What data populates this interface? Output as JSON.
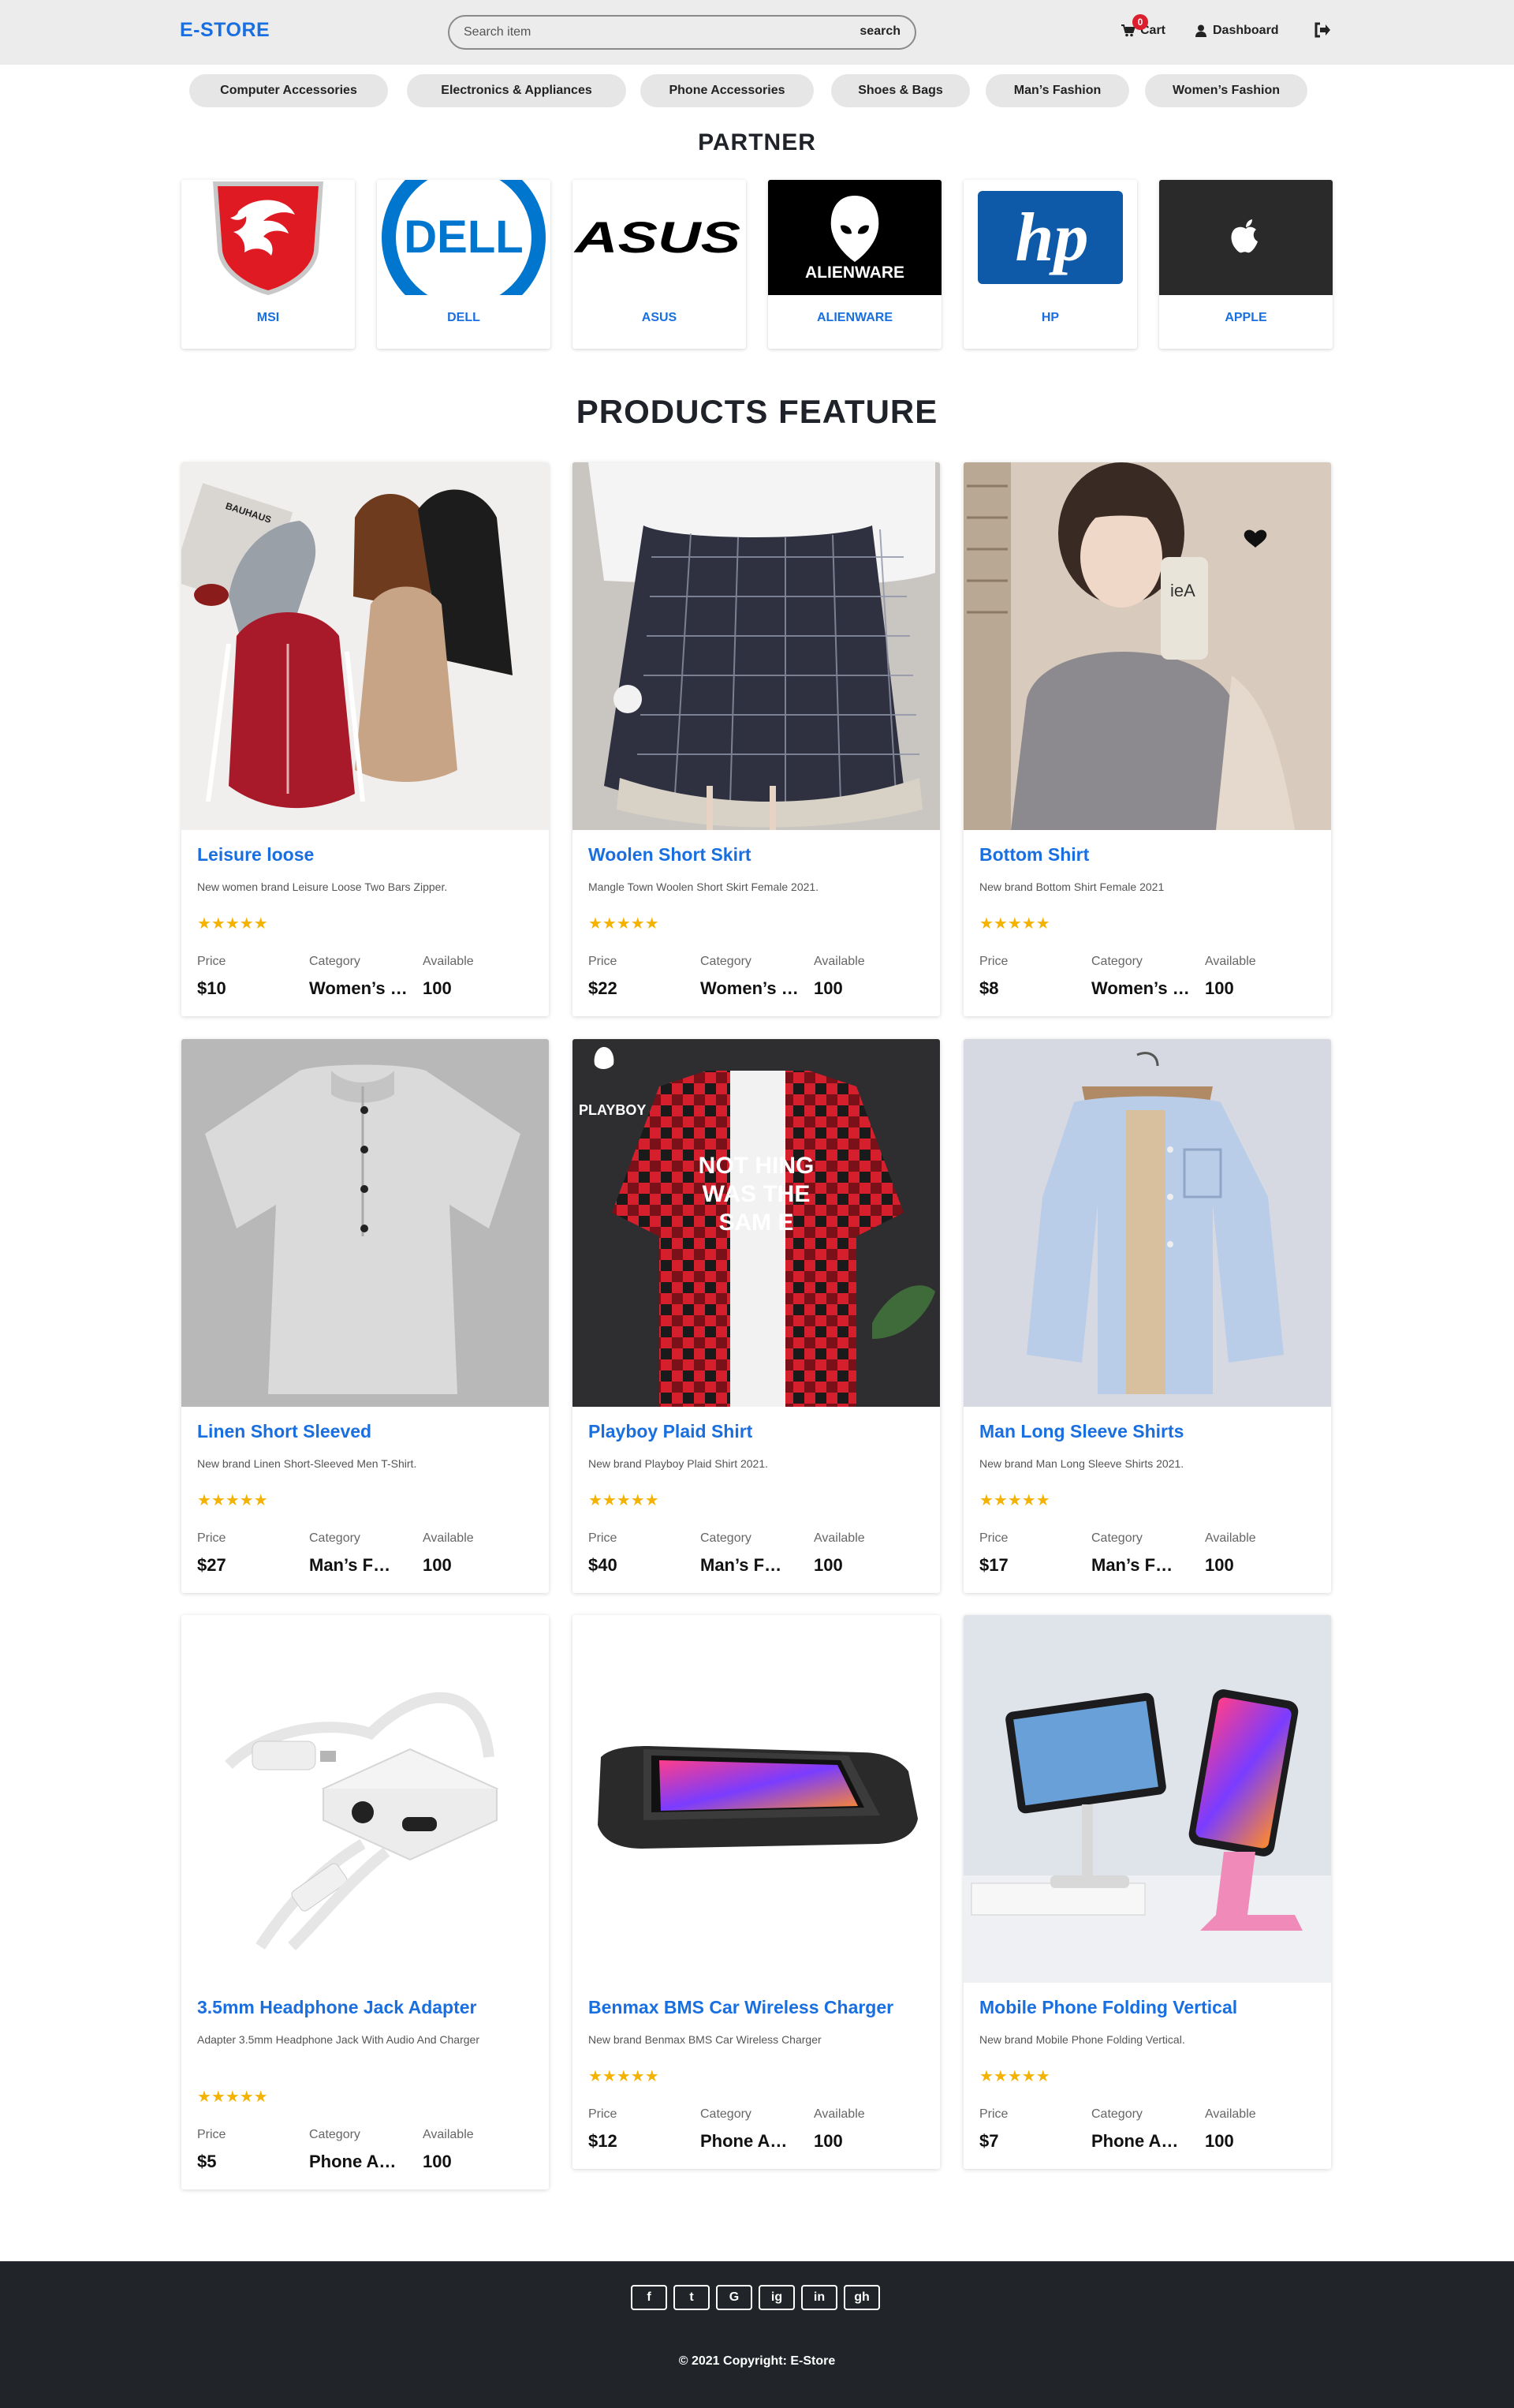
{
  "header": {
    "logo": "E-STORE",
    "search_placeholder": "Search item",
    "search_button": "search",
    "cart_count": "0",
    "cart_label": "Cart",
    "dashboard_label": "Dashboard"
  },
  "categories": [
    "Computer Accessories",
    "Electronics & Appliances",
    "Phone Accessories",
    "Shoes & Bags",
    "Man’s Fashion",
    "Women’s Fashion"
  ],
  "partners": {
    "title": "PARTNER",
    "items": [
      "MSI",
      "DELL",
      "ASUS",
      "ALIENWARE",
      "HP",
      "APPLE"
    ],
    "logo_text": {
      "dell": "DELL",
      "asus": "ASUS",
      "alienware": "ALIENWARE",
      "hp": "hp"
    }
  },
  "products": {
    "title": "PRODUCTS FEATURE",
    "labels": {
      "price": "Price",
      "category": "Category",
      "available": "Available"
    },
    "rating": "★★★★★",
    "items": [
      {
        "name": "Leisure loose",
        "desc": "New women brand Leisure Loose Two Bars Zipper.",
        "price": "$10",
        "category": "Women’s Fashion",
        "available": "100"
      },
      {
        "name": "Woolen Short Skirt",
        "desc": "Mangle Town Woolen Short Skirt Female 2021.",
        "price": "$22",
        "category": "Women’s Fashion",
        "available": "100"
      },
      {
        "name": "Bottom Shirt",
        "desc": "New brand Bottom Shirt Female 2021",
        "price": "$8",
        "category": "Women’s Fashion",
        "available": "100"
      },
      {
        "name": "Linen Short Sleeved",
        "desc": "New brand Linen Short-Sleeved Men T-Shirt.",
        "price": "$27",
        "category": "Man’s Fashion",
        "available": "100"
      },
      {
        "name": "Playboy Plaid Shirt",
        "desc": "New brand Playboy Plaid Shirt 2021.",
        "price": "$40",
        "category": "Man’s Fashion",
        "available": "100"
      },
      {
        "name": "Man Long Sleeve Shirts",
        "desc": "New brand Man Long Sleeve Shirts 2021.",
        "price": "$17",
        "category": "Man’s Fashion",
        "available": "100"
      },
      {
        "name": "3.5mm Headphone Jack Adapter",
        "desc": "Adapter 3.5mm Headphone Jack With Audio And Charger",
        "price": "$5",
        "category": "Phone Accessories",
        "available": "100"
      },
      {
        "name": "Benmax BMS Car Wireless Charger",
        "desc": "New brand Benmax BMS Car Wireless Charger",
        "price": "$12",
        "category": "Phone Accessories",
        "available": "100"
      },
      {
        "name": "Mobile Phone Folding Vertical",
        "desc": "New brand Mobile Phone Folding Vertical.",
        "price": "$7",
        "category": "Phone Accessories",
        "available": "100"
      }
    ]
  },
  "image_text": {
    "playboy": "PLAYBOY",
    "shirt_line1": "NOT HING",
    "shirt_line2": "WAS THE",
    "shirt_line3": "SAM E",
    "bauhaus": "BAUHAUS"
  },
  "footer": {
    "social": [
      "f",
      "t",
      "G",
      "ig",
      "in",
      "gh"
    ],
    "copyright": "© 2021 Copyright: E-Store"
  },
  "colors": {
    "brand": "#1a6fe0",
    "star": "#f5b301",
    "footer_bg": "#212529",
    "header_bg": "#ececec"
  }
}
